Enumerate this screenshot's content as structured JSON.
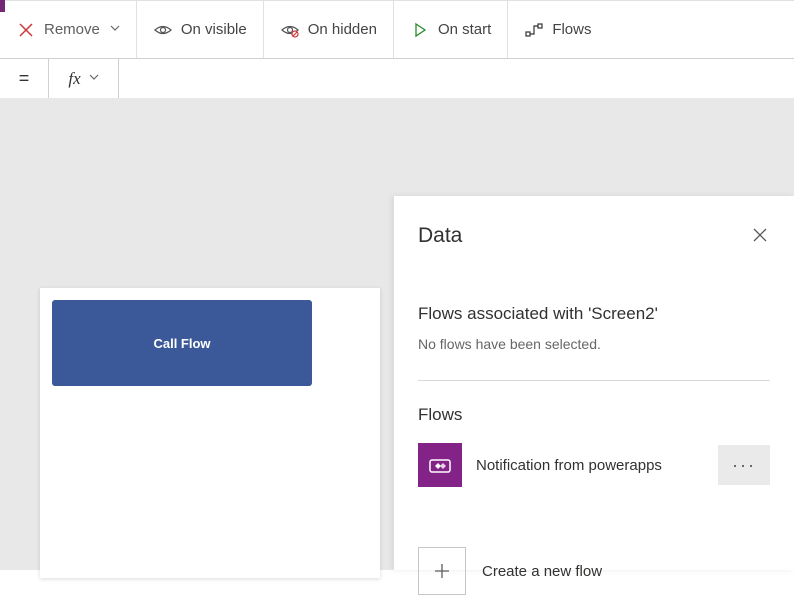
{
  "toolbar": {
    "remove_label": "Remove",
    "on_visible_label": "On visible",
    "on_hidden_label": "On hidden",
    "on_start_label": "On start",
    "flows_label": "Flows"
  },
  "formula_bar": {
    "eq": "=",
    "input_value": ""
  },
  "canvas": {
    "button_label": "Call Flow"
  },
  "data_panel": {
    "title": "Data",
    "associated_title": "Flows associated with 'Screen2'",
    "associated_msg": "No flows have been selected.",
    "flows_header": "Flows",
    "flow_item_label": "Notification from powerapps",
    "create_label": "Create a new flow"
  }
}
